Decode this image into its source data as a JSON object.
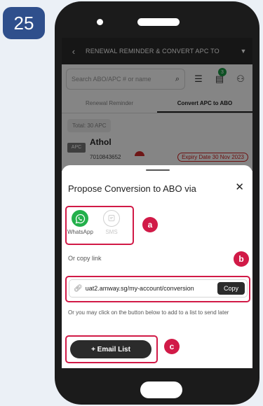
{
  "step": {
    "number": "25"
  },
  "colors": {
    "accent": "#d11a47",
    "badge": "#2f4f8c",
    "whatsapp": "#23b04b"
  },
  "app_bar": {
    "back_icon": "chevron-left-icon",
    "title": "RENEWAL REMINDER & CONVERT APC TO",
    "menu_icon": "chevron-down-icon"
  },
  "search": {
    "placeholder": "Search ABO/APC # or name",
    "filter_count": "3"
  },
  "tabs": [
    {
      "label": "Renewal Reminder"
    },
    {
      "label": "Convert APC to ABO"
    }
  ],
  "total": "Total: 30 APC",
  "member": {
    "type": "APC",
    "name": "Athol",
    "id": "7010843652",
    "expiry": "Expiry Date 30 Nov 2023"
  },
  "sheet": {
    "title": "Propose Conversion to ABO via",
    "close_icon": "close-icon",
    "share": [
      {
        "label": "WhatsApp",
        "icon": "whatsapp-icon"
      },
      {
        "label": "SMS",
        "icon": "sms-icon"
      }
    ],
    "copy_heading": "Or copy link",
    "link": "uat2.amway.sg/my-account/conversion",
    "copy_label": "Copy",
    "note": "Or you may click on the button below to add to a list to send later",
    "email_button": "+ Email List"
  },
  "markers": {
    "a": "a",
    "b": "b",
    "c": "c"
  }
}
